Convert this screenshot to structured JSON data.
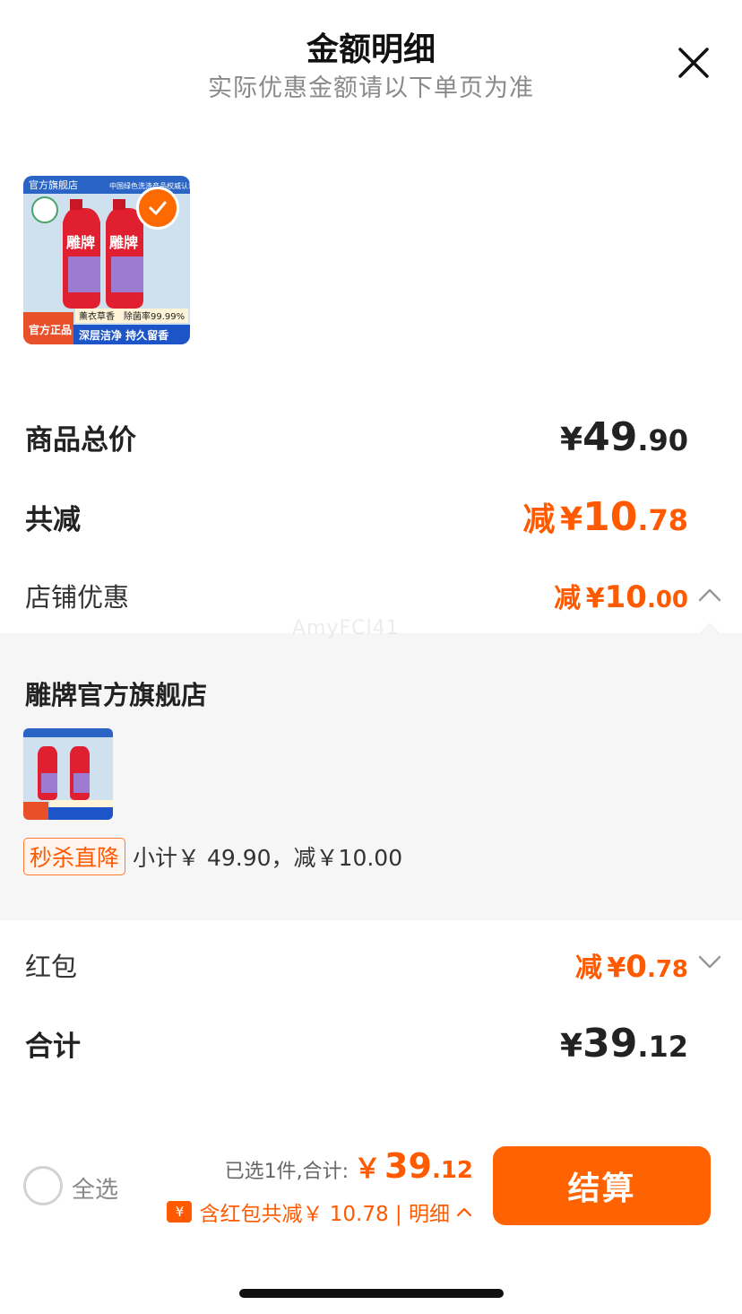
{
  "header": {
    "title": "金额明细",
    "subtitle": "实际优惠金额请以下单页为准",
    "close_icon": "close-icon"
  },
  "product": {
    "image_text": {
      "store_tag": "官方旗舰店",
      "top_banner": "中国绿色洗涤产品权威认证",
      "scent": "薰衣草香",
      "rate": "除菌率99.99%",
      "genuine": "官方正品",
      "slogan": "深层洁净 持久留香",
      "brand": "雕牌"
    },
    "selected": true
  },
  "summary": {
    "goods_total": {
      "label": "商品总价",
      "yen": "¥",
      "int": "49",
      "dec": ".90"
    },
    "total_reduce": {
      "label": "共减",
      "prefix": "减",
      "yen": "¥",
      "int": "10",
      "dec": ".78"
    },
    "store_discount": {
      "label": "店铺优惠",
      "prefix": "减",
      "yen": "¥",
      "int": "10",
      "dec": ".00",
      "expanded": true
    }
  },
  "store_panel": {
    "store_name": "雕牌官方旗舰店",
    "promo_tag": "秒杀直降",
    "promo_text": "小计￥ 49.90，减￥10.00"
  },
  "watermark": "AmyFCl41",
  "red_packet": {
    "label": "红包",
    "prefix": "减",
    "yen": "¥",
    "int": "0",
    "dec": ".78",
    "expanded": false
  },
  "total": {
    "label": "合计",
    "yen": "¥",
    "int": "39",
    "dec": ".12"
  },
  "bottom_bar": {
    "select_all": "全选",
    "selected_text": "已选1件,合计:",
    "yen": "￥",
    "int": "39",
    "dec": ".12",
    "discount_icon": "¥",
    "discount_text": "含红包共减￥ 10.78 | 明细",
    "checkout": "结算"
  },
  "colors": {
    "accent": "#ff5a00",
    "button": "#ff6200",
    "panel_bg": "#f6f6f6",
    "text_dark": "#222222"
  }
}
